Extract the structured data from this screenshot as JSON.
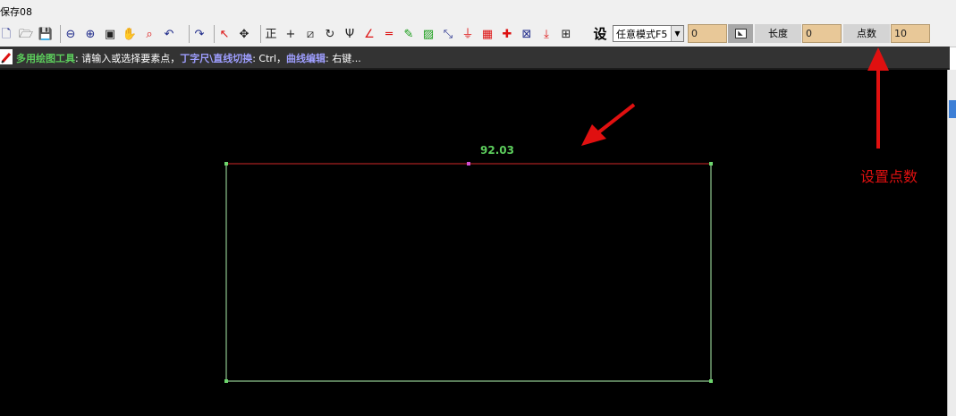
{
  "window": {
    "title": "保存08"
  },
  "toolbar": {
    "group1": [
      {
        "name": "new-file-icon",
        "glyph": "🗋",
        "cls": ""
      },
      {
        "name": "open-folder-icon",
        "glyph": "🗁",
        "cls": "dark"
      },
      {
        "name": "save-icon",
        "glyph": "💾",
        "cls": ""
      }
    ],
    "group2": [
      {
        "name": "zoom-out-icon",
        "glyph": "⊖",
        "cls": ""
      },
      {
        "name": "zoom-in-icon",
        "glyph": "⊕",
        "cls": ""
      },
      {
        "name": "zoom-extent-icon",
        "glyph": "▣",
        "cls": "dark"
      },
      {
        "name": "pan-hand-icon",
        "glyph": "✋",
        "cls": "dark"
      },
      {
        "name": "zoom-window-icon",
        "glyph": "⌕",
        "cls": "red"
      },
      {
        "name": "undo-icon",
        "glyph": "↶",
        "cls": ""
      }
    ],
    "group3": [
      {
        "name": "redo-icon",
        "glyph": "↷",
        "cls": ""
      }
    ],
    "group4": [
      {
        "name": "select-cursor-icon",
        "glyph": "↖",
        "cls": "red"
      },
      {
        "name": "move-cross-icon",
        "glyph": "✥",
        "cls": "dark"
      }
    ],
    "group5": [
      {
        "name": "orthogonal-icon",
        "glyph": "正",
        "cls": "dark"
      },
      {
        "name": "crosshair-icon",
        "glyph": "+",
        "cls": "dark"
      },
      {
        "name": "grid-snap-icon",
        "glyph": "⧄",
        "cls": "dark"
      },
      {
        "name": "rotate-icon",
        "glyph": "↻",
        "cls": "dark"
      },
      {
        "name": "psi-icon",
        "glyph": "Ψ",
        "cls": "dark"
      },
      {
        "name": "angle-line-icon",
        "glyph": "∠",
        "cls": "red"
      },
      {
        "name": "parallel-line-icon",
        "glyph": "═",
        "cls": "red"
      },
      {
        "name": "pencil-line-icon",
        "glyph": "✎",
        "cls": "green"
      },
      {
        "name": "hatch-icon",
        "glyph": "▨",
        "cls": "green"
      },
      {
        "name": "point-edit-icon",
        "glyph": "⤡",
        "cls": ""
      },
      {
        "name": "baseline-icon",
        "glyph": "⏚",
        "cls": "red"
      },
      {
        "name": "color-palette-icon",
        "glyph": "▦",
        "cls": "red"
      },
      {
        "name": "split-icon",
        "glyph": "✚",
        "cls": "red"
      },
      {
        "name": "diagonal-frame-icon",
        "glyph": "⊠",
        "cls": ""
      },
      {
        "name": "snap-point-icon",
        "glyph": "⤓",
        "cls": "red"
      },
      {
        "name": "grid-frame-icon",
        "glyph": "⊞",
        "cls": "dark"
      }
    ],
    "she_label": "设",
    "mode_select": "任意模式F5",
    "length_value_left": "0",
    "length_label": "长度",
    "length_value": "0",
    "points_label": "点数",
    "points_value": "10"
  },
  "hintbar": {
    "tool_name": "多用绘图工具",
    "part1": ": 请输入或选择要素点，",
    "toggle_label": "丁字尺\\直线切换",
    "part2": ": Ctrl，",
    "curve_label": "曲线编辑",
    "part3": ": 右键..."
  },
  "canvas": {
    "dimension_text": "92.03",
    "annotation_text": "设置点数"
  },
  "colors": {
    "canvas_bg": "#000000",
    "top_edge": "#8b1a1a",
    "other_edges": "#8ec68e",
    "annotation_red": "#e01010",
    "dimension_green": "#5ccd5c"
  }
}
